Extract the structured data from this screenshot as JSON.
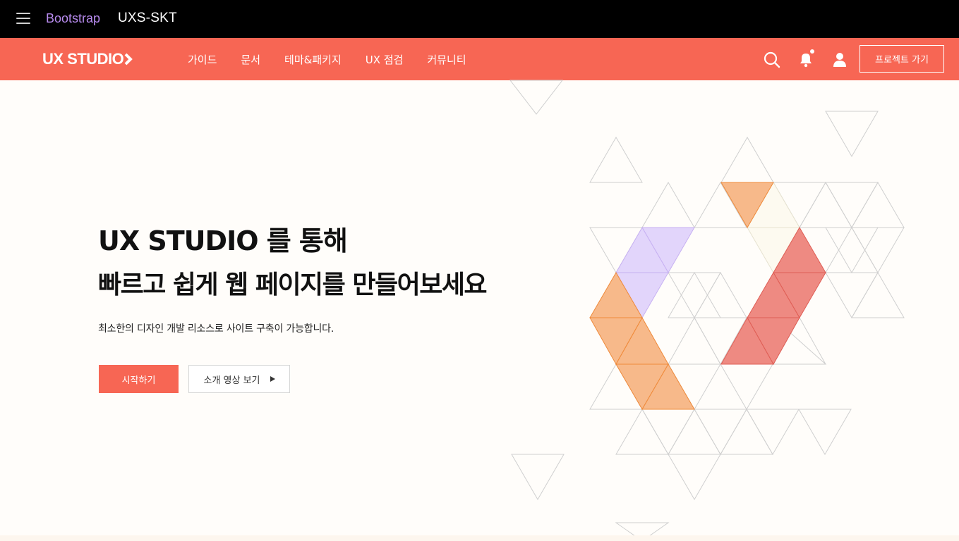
{
  "topbar": {
    "brand": "Bootstrap",
    "project_name": "UXS-SKT"
  },
  "navbar": {
    "logo": "UX STUDIO",
    "items": [
      {
        "label": "가이드"
      },
      {
        "label": "문서"
      },
      {
        "label": "테마&패키지"
      },
      {
        "label": "UX 점검"
      },
      {
        "label": "커뮤니티"
      }
    ],
    "icons": [
      "search-icon",
      "bell-icon",
      "user-icon"
    ],
    "project_button": "프로젝트 가기"
  },
  "hero": {
    "title_line1": "UX STUDIO 를 통해",
    "title_line2": "빠르고 쉽게 웹 페이지를 만들어보세요",
    "description": "최소한의 디자인 개발 리소스로 사이트 구축이 가능합니다.",
    "start_button": "시작하기",
    "video_button": "소개 영상 보기"
  },
  "colors": {
    "accent": "#f76654",
    "topbar": "#000000",
    "brand_purple": "#b98cf0",
    "orange_fill": "#f7b98a",
    "purple_fill": "#e2d5fb",
    "red_fill": "#ee8a82"
  }
}
